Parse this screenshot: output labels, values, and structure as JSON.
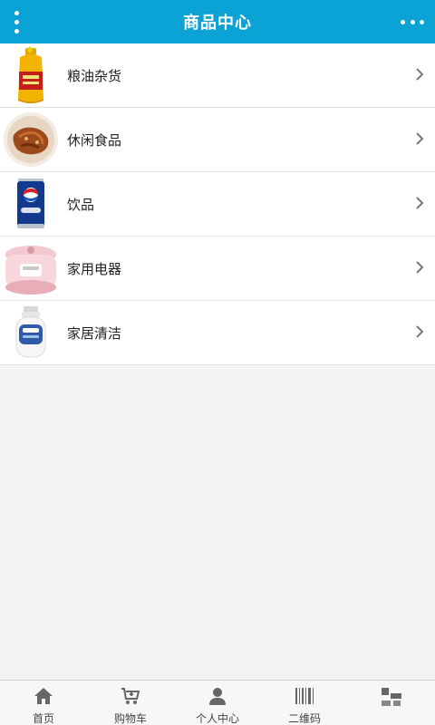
{
  "header": {
    "title": "商品中心",
    "menu_icon": "vertical-dots-icon",
    "more_icon": "horizontal-dots-icon",
    "color": "#0ba2d6"
  },
  "categories": [
    {
      "label": "粮油杂货",
      "image": "cooking-oil-bottle"
    },
    {
      "label": "休闲食品",
      "image": "fried-snack-plate"
    },
    {
      "label": "饮品",
      "image": "pepsi-can"
    },
    {
      "label": "家用电器",
      "image": "rice-cooker"
    },
    {
      "label": "家居清洁",
      "image": "dove-body-wash-bottle"
    }
  ],
  "tabbar": {
    "items": [
      {
        "label": "首页",
        "icon": "home-icon"
      },
      {
        "label": "购物车",
        "icon": "cart-icon"
      },
      {
        "label": "个人中心",
        "icon": "user-icon"
      },
      {
        "label": "二维码",
        "icon": "barcode-icon"
      },
      {
        "label": "",
        "icon": "blocks-icon"
      }
    ]
  }
}
